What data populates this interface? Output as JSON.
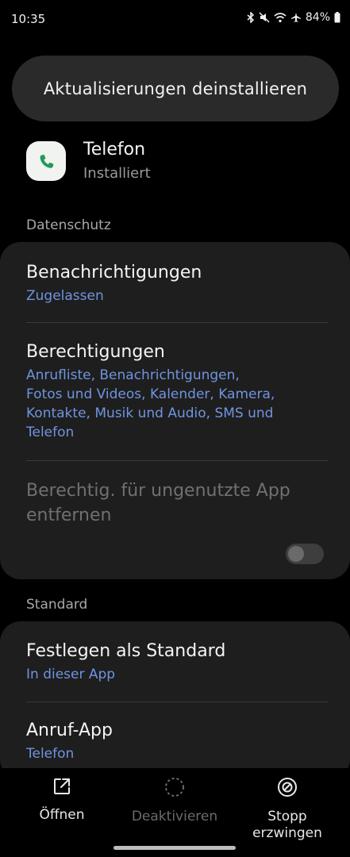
{
  "status_bar": {
    "time": "10:35",
    "battery": "84%",
    "icons": [
      "bluetooth-icon",
      "mute-icon",
      "wifi-icon",
      "airplane-icon",
      "battery-icon"
    ]
  },
  "uninstall_button": {
    "label": "Aktualisierungen deinstallieren"
  },
  "app": {
    "name": "Telefon",
    "status": "Installiert",
    "icon": "phone-icon",
    "icon_color": "#1e9c5a"
  },
  "sections": {
    "privacy": {
      "title": "Datenschutz",
      "notifications": {
        "title": "Benachrichtigungen",
        "value": "Zugelassen"
      },
      "permissions": {
        "title": "Berechtigungen",
        "value_lines": [
          "Anrufliste, Benachrichtigungen,",
          "Fotos und Videos, Kalender, Kamera,",
          "Kontakte, Musik und Audio, SMS und",
          "Telefon"
        ]
      },
      "remove_permissions": {
        "title_lines": [
          "Berechtig. für ungenutzte App",
          "entfernen"
        ],
        "enabled": false
      }
    },
    "default": {
      "title": "Standard",
      "set_default": {
        "title": "Festlegen als Standard",
        "value": "In dieser App"
      },
      "call_app": {
        "title": "Anruf-App",
        "value": "Telefon"
      }
    }
  },
  "bottom_nav": {
    "open": {
      "label": "Öffnen",
      "icon": "open-external-icon"
    },
    "disable": {
      "label": "Deaktivieren",
      "icon": "disable-icon"
    },
    "force_stop": {
      "label_lines": [
        "Stopp",
        "erzwingen"
      ],
      "icon": "force-stop-icon"
    }
  },
  "colors": {
    "accent_link": "#6f94e0",
    "card_background": "#1e1e1e",
    "background": "#000000"
  }
}
